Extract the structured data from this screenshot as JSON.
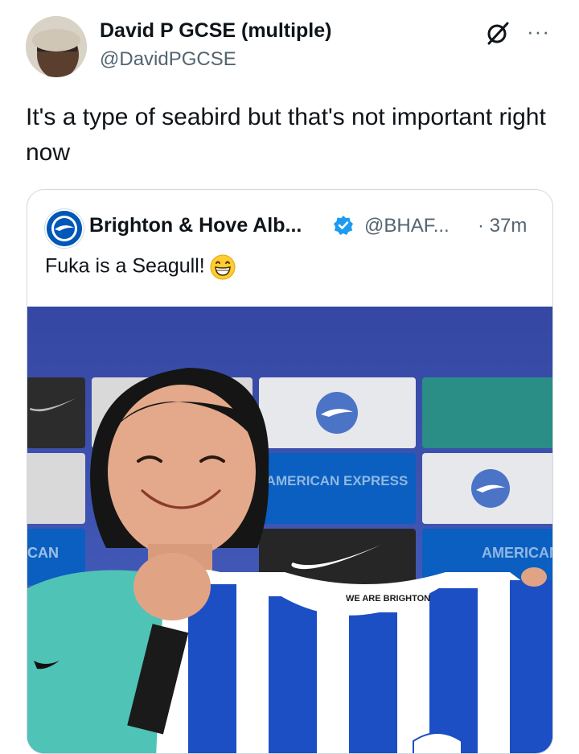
{
  "post": {
    "author_name": "David P GCSE (multiple)",
    "author_handle": "@DavidPGCSE",
    "text": "It's a type of seabird but that's not important right now",
    "more_label": "···"
  },
  "quoted": {
    "author_name": "Brighton & Hove Alb...",
    "author_handle": "@BHAF...",
    "time": "· 37m",
    "text": "Fuka is a Seagull!",
    "verified_color": "#1d9bf0",
    "image": {
      "board_text_1": "AMERICAN EXPRESS",
      "board_text_2": "AMERICAN",
      "board_text_3": "CAN",
      "shirt_label": "WE ARE BRIGHTON"
    }
  },
  "colors": {
    "brighton_blue": "#0057b8",
    "text_primary": "#0f1419",
    "text_secondary": "#536471"
  }
}
